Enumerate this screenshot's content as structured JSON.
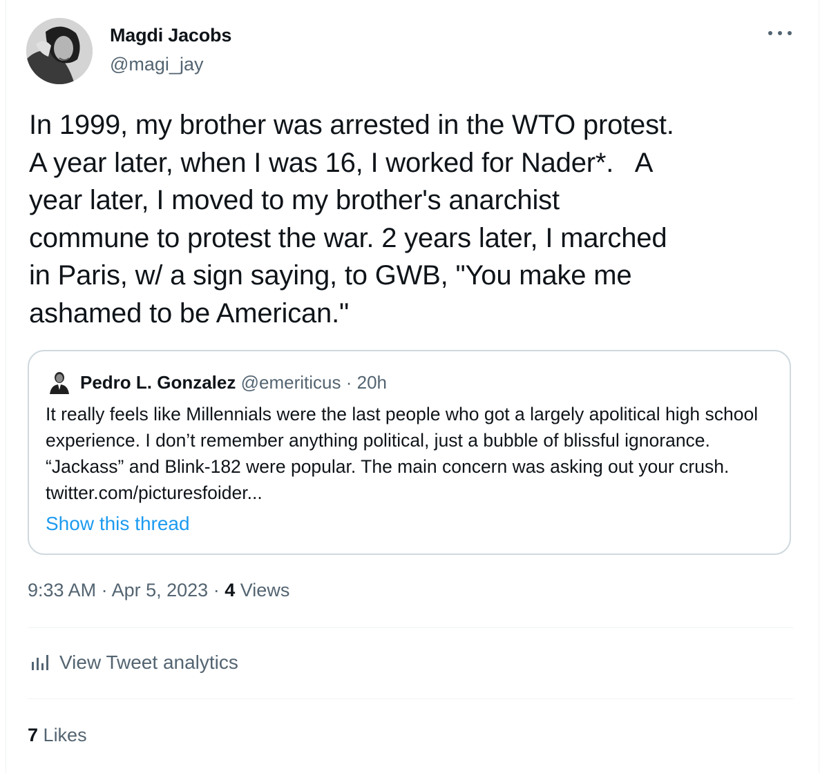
{
  "author": {
    "name": "Magdi Jacobs",
    "handle": "@magi_jay",
    "avatar_icon": "profile-photo"
  },
  "more_icon": "more-horizontal-icon",
  "tweet": {
    "text": "In 1999, my brother was arrested in the WTO protest.\nA year later, when I was 16, I worked for Nader*.   A\nyear later, I moved to my brother's anarchist\ncommune to protest the war. 2 years later, I marched\nin Paris, w/ a sign saying, to GWB, \"You make me\nashamed to be American.\""
  },
  "quoted_tweet": {
    "name": "Pedro L. Gonzalez",
    "handle": "@emeriticus",
    "separator": "·",
    "time": "20h",
    "text": "It really feels like Millennials were the last people who got a largely apolitical high school experience. I don’t remember anything political, just a bubble of blissful ignorance. “Jackass” and Blink-182 were popular. The main concern was asking out your crush. twitter.com/picturesfoider...",
    "show_thread": "Show this thread"
  },
  "meta": {
    "time": "9:33 AM",
    "sep1": "·",
    "date": "Apr 5, 2023",
    "sep2": "·",
    "views_count": "4",
    "views_label": "Views"
  },
  "analytics": {
    "label": "View Tweet analytics",
    "icon": "analytics-bar-icon"
  },
  "likes": {
    "count": "7",
    "label": "Likes"
  },
  "colors": {
    "text_primary": "#0f1419",
    "text_secondary": "#536471",
    "link": "#1d9bf0",
    "border": "#cfd9de",
    "divider": "#eff3f4"
  }
}
